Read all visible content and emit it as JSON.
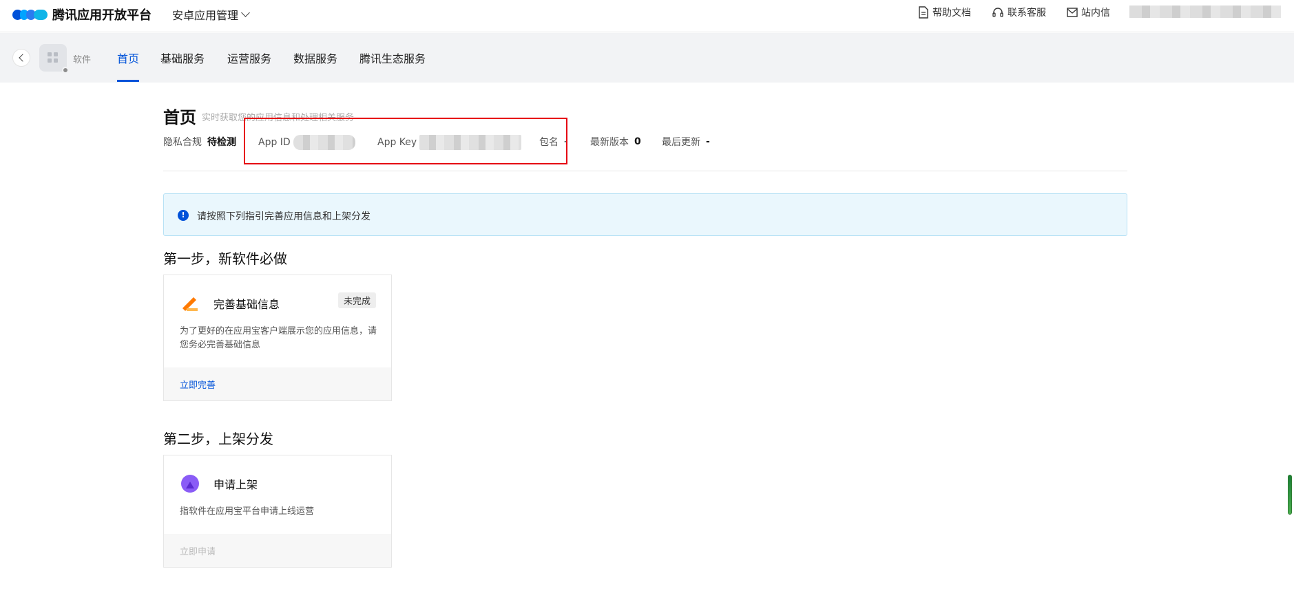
{
  "header": {
    "brand": "腾讯应用开放平台",
    "app_switch": "安卓应用管理",
    "help_docs": "帮助文档",
    "contact": "联系客服",
    "inbox": "站内信"
  },
  "subnav": {
    "app_name": "软件",
    "tabs": [
      "首页",
      "基础服务",
      "运营服务",
      "数据服务",
      "腾讯生态服务"
    ],
    "active_tab": "首页"
  },
  "page": {
    "title": "首页",
    "subtitle": "实时获取您的应用信息和处理相关服务",
    "meta": {
      "privacy_label": "隐私合规",
      "privacy_value": "待检测",
      "app_id_label": "App ID",
      "app_key_label": "App Key",
      "package_label": "包名",
      "package_value": "-",
      "version_label": "最新版本",
      "version_value": "0",
      "updated_label": "最后更新",
      "updated_value": "-"
    },
    "notice": "请按照下列指引完善应用信息和上架分发"
  },
  "steps": [
    {
      "title": "第一步，新软件必做",
      "card_title": "完善基础信息",
      "badge": "未完成",
      "desc": "为了更好的在应用宝客户端展示您的应用信息，请您务必完善基础信息",
      "action": "立即完善"
    },
    {
      "title": "第二步，上架分发",
      "card_title": "申请上架",
      "desc": "指软件在应用宝平台申请上线运营",
      "action": "立即申请"
    }
  ],
  "colors": {
    "accent": "#0052d9",
    "highlight": "#e60012"
  }
}
